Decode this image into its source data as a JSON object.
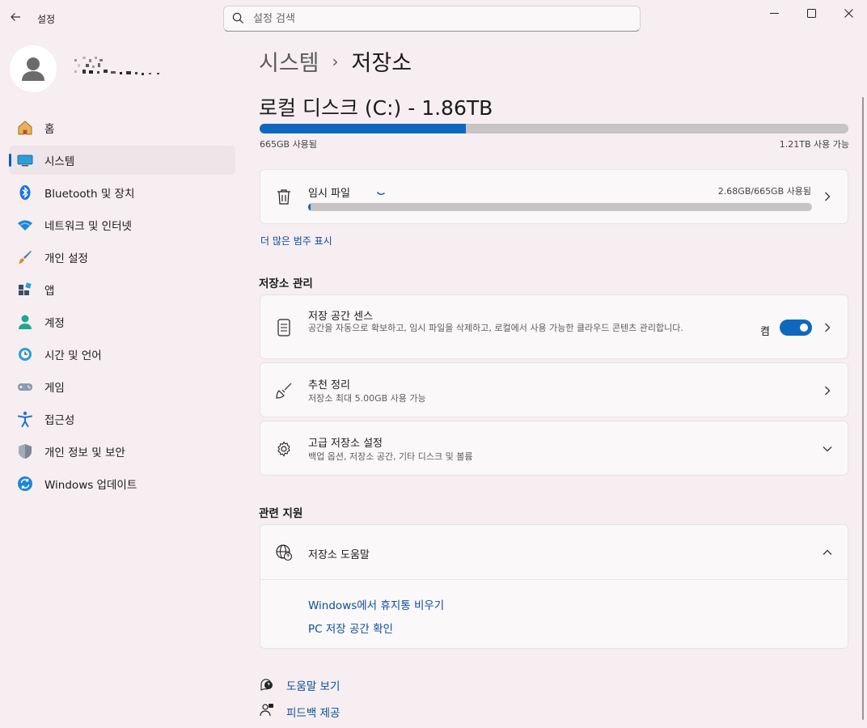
{
  "app": {
    "title": "설정"
  },
  "search": {
    "placeholder": "설정 검색"
  },
  "sidebar": {
    "items": [
      {
        "label": "홈",
        "icon": "home-icon"
      },
      {
        "label": "시스템",
        "icon": "system-icon",
        "selected": true
      },
      {
        "label": "Bluetooth 및 장치",
        "icon": "bluetooth-icon"
      },
      {
        "label": "네트워크 및 인터넷",
        "icon": "wifi-icon"
      },
      {
        "label": "개인 설정",
        "icon": "brush-icon"
      },
      {
        "label": "앱",
        "icon": "apps-icon"
      },
      {
        "label": "계정",
        "icon": "account-icon"
      },
      {
        "label": "시간 및 언어",
        "icon": "time-language-icon"
      },
      {
        "label": "게임",
        "icon": "gamepad-icon"
      },
      {
        "label": "접근성",
        "icon": "accessibility-icon"
      },
      {
        "label": "개인 정보 및 보안",
        "icon": "shield-icon"
      },
      {
        "label": "Windows 업데이트",
        "icon": "update-icon"
      }
    ]
  },
  "breadcrumb": {
    "parent": "시스템",
    "separator": "›",
    "current": "저장소"
  },
  "disk": {
    "title": "로컬 디스크 (C:) - 1.86TB",
    "used_label": "665GB 사용됨",
    "free_label": "1.21TB 사용 가능",
    "used_fraction": 0.35
  },
  "temp_files": {
    "title": "임시 파일",
    "usage": "2.68GB/665GB 사용됨",
    "used_fraction": 0.004
  },
  "more_categories": "더 많은 범주 표시",
  "storage_management": {
    "heading": "저장소 관리",
    "storage_sense": {
      "title": "저장 공간 센스",
      "description": "공간을 자동으로 확보하고, 임시 파일을 삭제하고, 로컬에서 사용 가능한 클라우드 콘텐츠 관리합니다.",
      "toggle_label": "켬",
      "toggle_on": true
    },
    "cleanup": {
      "title": "추천 정리",
      "description": "저장소 최대 5.00GB 사용 가능"
    },
    "advanced": {
      "title": "고급 저장소 설정",
      "description": "백업 옵션, 저장소 공간, 기타 디스크 및 볼륨"
    }
  },
  "related_support": {
    "heading": "관련 지원",
    "help_title": "저장소 도움말",
    "links": [
      "Windows에서 휴지통 비우기",
      "PC 저장 공간 확인"
    ]
  },
  "footer": {
    "get_help": "도움말 보기",
    "feedback": "피드백 제공"
  },
  "colors": {
    "accent": "#0f67c0",
    "link": "#0a4fa0",
    "background": "#f6eef0"
  }
}
